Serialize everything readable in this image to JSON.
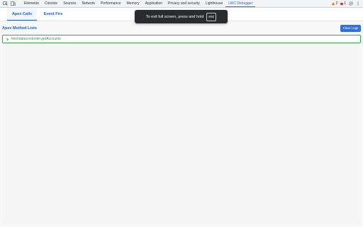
{
  "devtools": {
    "tabs": [
      {
        "label": "Elements"
      },
      {
        "label": "Console"
      },
      {
        "label": "Sources"
      },
      {
        "label": "Network"
      },
      {
        "label": "Performance"
      },
      {
        "label": "Memory"
      },
      {
        "label": "Application"
      },
      {
        "label": "Privacy and security"
      },
      {
        "label": "Lighthouse"
      },
      {
        "label": "LWC Debugger",
        "active": true
      }
    ],
    "warnings_count": "2",
    "errors_count": "1",
    "icons": [
      "inspect-icon",
      "device-toggle-icon",
      "settings-icon",
      "more-options-icon"
    ]
  },
  "panel": {
    "tabs": [
      {
        "label": "Apex Calls",
        "active": true
      },
      {
        "label": "Event Firs"
      }
    ],
    "section_title": "Apex Method Lists",
    "clear_button": "Clear Logs",
    "methods": [
      {
        "label": "fetchdatacontroller.getAccounts"
      }
    ],
    "accent_color": "#1a61c9",
    "success_color": "#2e9f3c"
  },
  "toast": {
    "text": "To exit full screen, press and hold",
    "key": "esc"
  }
}
